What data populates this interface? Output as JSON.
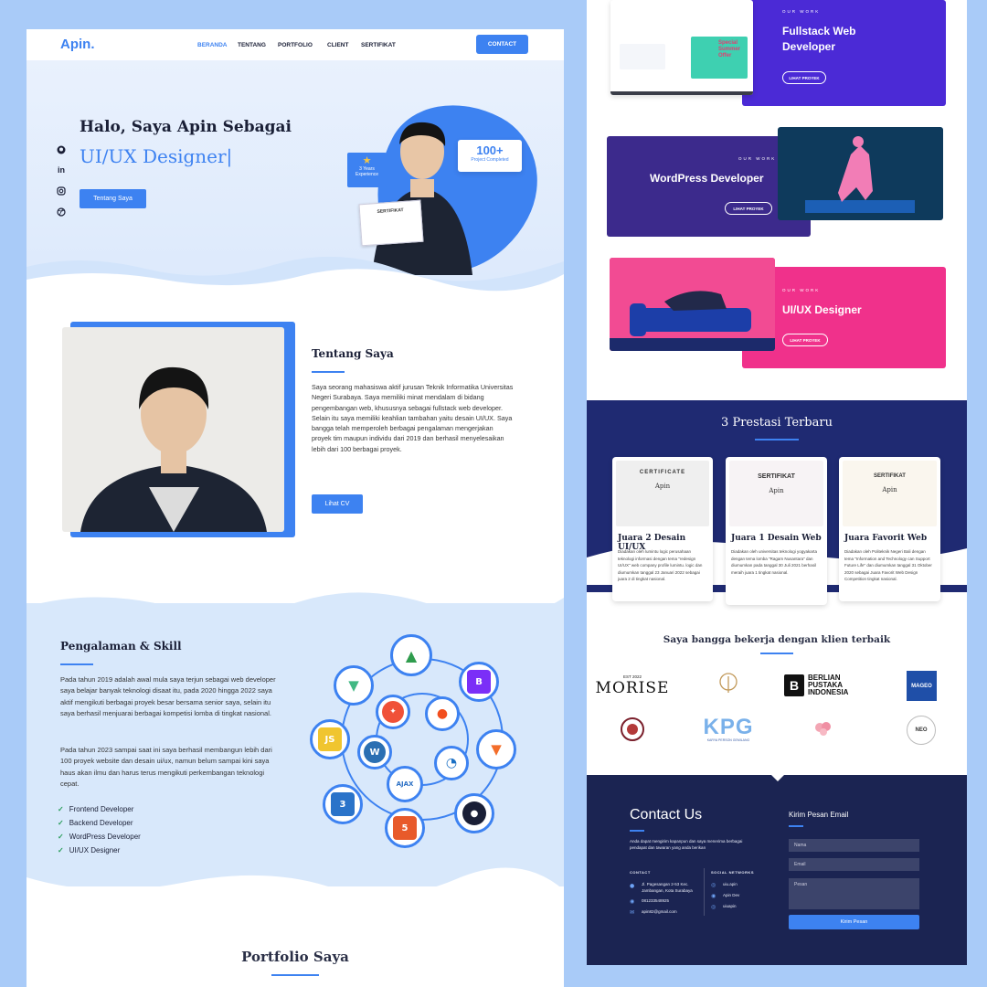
{
  "nav": {
    "logo": "Apin.",
    "links": [
      "BERANDA",
      "TENTANG",
      "PORTFOLIO",
      "CLIENT",
      "SERTIFIKAT"
    ],
    "contact_label": "CONTACT"
  },
  "hero": {
    "greeting": "Halo, Saya Apin Sebagai",
    "role": "UI/UX Designer|",
    "cta": "Tentang Saya",
    "badge_years": "3 Years Experience",
    "badge_projects_count": "100+",
    "badge_projects_label": "Project Completed",
    "cert_label": "SERTIFIKAT"
  },
  "about": {
    "title": "Tentang Saya",
    "body": "Saya seorang mahasiswa aktif jurusan Teknik Informatika Universitas Negeri Surabaya. Saya memiliki minat mendalam di bidang pengembangan web, khususnya sebagai fullstack web developer. Selain itu saya memiliki keahlian tambahan yaitu desain UI/UX. Saya bangga telah memperoleh berbagai pengalaman mengerjakan proyek tim maupun individu dari 2019 dan berhasil menyelesaikan lebih dari 100 berbagai proyek.",
    "cta": "Lihat CV"
  },
  "experience": {
    "title": "Pengalaman & Skill",
    "para1": "Pada tahun 2019 adalah awal mula saya terjun sebagai web developer saya belajar banyak teknologi disaat itu, pada 2020 hingga 2022 saya aktif mengikuti berbagai proyek besar bersama senior saya, selain itu saya berhasil menjuarai berbagai kompetisi lomba di tingkat nasional.",
    "para2": "Pada tahun 2023 sampai saat ini saya berhasil membangun lebih dari 100 proyek website dan desain ui/ux, namun belum sampai kini saya haus akan ilmu dan harus terus mengikuti perkembangan teknologi cepat.",
    "skills": [
      "Frontend Developer",
      "Backend Developer",
      "WordPress Developer",
      "UI/UX Designer"
    ]
  },
  "portfolio": {
    "title": "Portfolio Saya",
    "items": [
      {
        "eyebrow": "OUR WORK",
        "title": "Fullstack Web Developer",
        "cta": "LIHAT PROYEK",
        "color": "#4b2ad6"
      },
      {
        "eyebrow": "OUR WORK",
        "title": "WordPress Developer",
        "cta": "LIHAT PROYEK",
        "color": "#3c2a8c"
      },
      {
        "eyebrow": "OUR WORK",
        "title": "UI/UX Designer",
        "cta": "LIHAT PROYEK",
        "color": "#f0318b"
      }
    ],
    "mock_offer": "Special Summer Offer"
  },
  "awards": {
    "title": "3 Prestasi Terbaru",
    "items": [
      {
        "cert": "CERTIFICATE",
        "name": "Apin",
        "title": "Juara 2 Desain UI/UX",
        "desc": "Diadakan oleh lumintu logic perusahaan teknologi informasi dengan tema \"redesign UI/UX\" web company profile lumintu. logic dan diumumkan tanggal 23 Januari 2022 sebagai juara 2 di tingkat nasional."
      },
      {
        "cert": "SERTIFIKAT",
        "name": "Apin",
        "title": "Juara 1 Desain Web",
        "desc": "Diadakan oleh universitas teknologi yogyakarta dengan tema lomba \"Ragam Nusantara\" dan diumumkan pada tanggal 30 Juli 2021 berhasil meraih juara 1 tingkat nasional."
      },
      {
        "cert": "SERTIFIKAT",
        "name": "Apin",
        "title": "Juara Favorit Web",
        "desc": "Diadakan oleh Politeknik Negeri Bali dengan tema \"Information and Technology can Support Future Life\" dan diumumkan tanggal 31 Oktober 2020 sebagai Juara Favorit Web Design Competition tingkat nasional."
      }
    ]
  },
  "clients": {
    "title": "Saya bangga bekerja dengan klien terbaik",
    "morise_est": "EST 2022",
    "morise": "MORISE",
    "berlian": "BERLIAN PUSTAKA INDONESIA",
    "berlian_mark": "B",
    "mageo": "MAGEO",
    "kpg": "KPG",
    "kpg_sub": "KARYA PERSON GEMILANG",
    "neo": "NEO"
  },
  "contact": {
    "title": "Contact Us",
    "desc": "Anda dapat mengirim kapanpun dan saya menerima berbagai pendapat dan tawaran yang anda berikan",
    "contact_heading": "CONTACT",
    "address": "Jl. Pagesangan 2-53 Kec. Jambangan, Kota Surabaya",
    "phone": "081233548925",
    "email": "apin82@gmail.com",
    "social_heading": "SOCIAL NETWORKS",
    "socials": [
      "uiu.apin",
      "Apin Dev",
      "uiuapin"
    ],
    "form_title": "Kirim Pesan Email",
    "name_placeholder": "Nama",
    "email_placeholder": "Email",
    "message_placeholder": "Pesan",
    "submit": "Kirim Pesan"
  }
}
